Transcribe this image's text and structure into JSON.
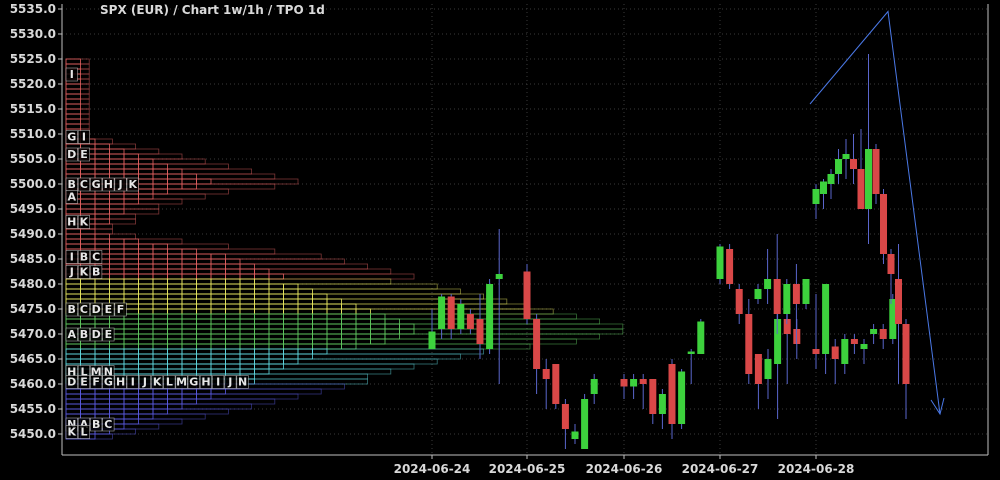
{
  "header": {
    "title": "SPX (EUR) /  Chart 1w/1h / TPO 1d"
  },
  "colors": {
    "background": "#000000",
    "grid": "#3a3a3a",
    "axis": "#bfbfbf",
    "text": "#d9d9d9",
    "bull": "#3dd13d",
    "bear": "#d94848",
    "wick": "#5a66cc",
    "trend": "#4a78e6",
    "tpo_red": "#e06060",
    "tpo_yellow": "#e8e860",
    "tpo_green": "#60c860",
    "tpo_cyan": "#60d8e0",
    "tpo_blue": "#5a5ae0"
  },
  "chart_data": {
    "type": "candlestick",
    "title": "SPX (EUR) /  Chart 1w/1h / TPO 1d",
    "y_ticks": [
      5450.0,
      5455.0,
      5460.0,
      5465.0,
      5470.0,
      5475.0,
      5480.0,
      5485.0,
      5490.0,
      5495.0,
      5500.0,
      5505.0,
      5510.0,
      5515.0,
      5520.0,
      5525.0,
      5530.0,
      5535.0
    ],
    "y_range": [
      5447.0,
      5536.0
    ],
    "y_axis_position": "left",
    "x_ticks": [
      "2024-06-24",
      "2024-06-25",
      "2024-06-26",
      "2024-06-27",
      "2024-06-28"
    ],
    "grid": true,
    "candles": [
      {
        "day": 0,
        "hour": 0,
        "o": 5467.0,
        "h": 5475.0,
        "l": 5467.0,
        "c": 5470.5
      },
      {
        "day": 0,
        "hour": 1,
        "o": 5471.0,
        "h": 5478.0,
        "l": 5469.0,
        "c": 5477.5
      },
      {
        "day": 0,
        "hour": 2,
        "o": 5477.5,
        "h": 5478.0,
        "l": 5469.0,
        "c": 5471.0
      },
      {
        "day": 0,
        "hour": 3,
        "o": 5471.0,
        "h": 5477.0,
        "l": 5470.0,
        "c": 5476.0
      },
      {
        "day": 0,
        "hour": 4,
        "o": 5474.0,
        "h": 5475.0,
        "l": 5470.0,
        "c": 5471.0
      },
      {
        "day": 0,
        "hour": 5,
        "o": 5473.0,
        "h": 5478.0,
        "l": 5465.0,
        "c": 5468.0
      },
      {
        "day": 0,
        "hour": 6,
        "o": 5467.0,
        "h": 5481.0,
        "l": 5466.0,
        "c": 5480.0
      },
      {
        "day": 0,
        "hour": 7,
        "o": 5481.0,
        "h": 5491.0,
        "l": 5460.0,
        "c": 5482.0
      },
      {
        "day": 1,
        "hour": 0,
        "o": 5482.5,
        "h": 5484.0,
        "l": 5472.0,
        "c": 5473.0
      },
      {
        "day": 1,
        "hour": 1,
        "o": 5473.0,
        "h": 5474.0,
        "l": 5458.0,
        "c": 5463.0
      },
      {
        "day": 1,
        "hour": 2,
        "o": 5463.0,
        "h": 5465.0,
        "l": 5455.0,
        "c": 5461.0
      },
      {
        "day": 1,
        "hour": 3,
        "o": 5464.0,
        "h": 5464.0,
        "l": 5455.0,
        "c": 5456.0
      },
      {
        "day": 1,
        "hour": 4,
        "o": 5456.0,
        "h": 5457.0,
        "l": 5447.0,
        "c": 5451.0
      },
      {
        "day": 1,
        "hour": 5,
        "o": 5449.0,
        "h": 5452.0,
        "l": 5448.0,
        "c": 5450.5
      },
      {
        "day": 1,
        "hour": 6,
        "o": 5447.0,
        "h": 5458.0,
        "l": 5447.0,
        "c": 5457.0
      },
      {
        "day": 1,
        "hour": 7,
        "o": 5458.0,
        "h": 5462.0,
        "l": 5456.0,
        "c": 5461.0
      },
      {
        "day": 2,
        "hour": 0,
        "o": 5461.0,
        "h": 5462.0,
        "l": 5457.0,
        "c": 5459.5
      },
      {
        "day": 2,
        "hour": 1,
        "o": 5459.5,
        "h": 5462.0,
        "l": 5457.0,
        "c": 5461.0
      },
      {
        "day": 2,
        "hour": 2,
        "o": 5461.0,
        "h": 5462.0,
        "l": 5455.0,
        "c": 5460.0
      },
      {
        "day": 2,
        "hour": 3,
        "o": 5461.0,
        "h": 5461.0,
        "l": 5452.0,
        "c": 5454.0
      },
      {
        "day": 2,
        "hour": 4,
        "o": 5454.0,
        "h": 5459.0,
        "l": 5451.0,
        "c": 5458.0
      },
      {
        "day": 2,
        "hour": 5,
        "o": 5464.0,
        "h": 5465.0,
        "l": 5449.0,
        "c": 5452.0
      },
      {
        "day": 2,
        "hour": 6,
        "o": 5452.0,
        "h": 5463.0,
        "l": 5451.0,
        "c": 5462.5
      },
      {
        "day": 2,
        "hour": 7,
        "o": 5466.0,
        "h": 5467.0,
        "l": 5460.0,
        "c": 5466.5
      },
      {
        "day": 2,
        "hour": 8,
        "o": 5466.0,
        "h": 5473.0,
        "l": 5466.0,
        "c": 5472.5
      },
      {
        "day": 3,
        "hour": 0,
        "o": 5481.0,
        "h": 5488.0,
        "l": 5480.0,
        "c": 5487.5
      },
      {
        "day": 3,
        "hour": 1,
        "o": 5487.0,
        "h": 5488.0,
        "l": 5479.0,
        "c": 5480.0
      },
      {
        "day": 3,
        "hour": 2,
        "o": 5479.0,
        "h": 5480.0,
        "l": 5472.0,
        "c": 5474.0
      },
      {
        "day": 3,
        "hour": 3,
        "o": 5474.0,
        "h": 5477.0,
        "l": 5460.0,
        "c": 5462.0
      },
      {
        "day": 3,
        "hour": 4,
        "o": 5466.0,
        "h": 5466.0,
        "l": 5455.0,
        "c": 5460.0
      },
      {
        "day": 3,
        "hour": 5,
        "o": 5461.0,
        "h": 5467.0,
        "l": 5457.0,
        "c": 5465.0
      },
      {
        "day": 3,
        "hour": 6,
        "o": 5464.0,
        "h": 5474.0,
        "l": 5453.0,
        "c": 5473.0
      },
      {
        "day": 3,
        "hour": 7,
        "o": 5473.0,
        "h": 5474.0,
        "l": 5460.0,
        "c": 5470.0
      },
      {
        "day": 3,
        "hour": 8,
        "o": 5471.0,
        "h": 5473.0,
        "l": 5465.0,
        "c": 5468.0
      },
      {
        "day": 4,
        "hour": 0,
        "o": 5467.0,
        "h": 5478.0,
        "l": 5463.0,
        "c": 5466.0
      },
      {
        "day": 4,
        "hour": 1,
        "o": 5466.0,
        "h": 5476.0,
        "l": 5462.0,
        "c": 5480.0
      },
      {
        "day": 4,
        "hour": 2,
        "o": 5467.5,
        "h": 5469.0,
        "l": 5460.0,
        "c": 5465.0
      },
      {
        "day": 4,
        "hour": 3,
        "o": 5464.0,
        "h": 5470.0,
        "l": 5462.0,
        "c": 5469.0
      },
      {
        "day": 4,
        "hour": 4,
        "o": 5469.0,
        "h": 5470.0,
        "l": 5466.0,
        "c": 5468.0
      },
      {
        "day": 4,
        "hour": 5,
        "o": 5467.0,
        "h": 5469.0,
        "l": 5464.0,
        "c": 5468.0
      },
      {
        "day": 4,
        "hour": 6,
        "o": 5470.0,
        "h": 5472.0,
        "l": 5468.0,
        "c": 5471.0
      },
      {
        "day": 4,
        "hour": 7,
        "o": 5471.0,
        "h": 5472.0,
        "l": 5467.0,
        "c": 5469.0
      },
      {
        "day": 4,
        "hour": 8,
        "o": 5469.0,
        "h": 5478.0,
        "l": 5468.0,
        "c": 5477.0
      },
      {
        "day": 5,
        "hour": 0,
        "o": 5477.0,
        "h": 5480.0,
        "l": 5476.0,
        "c": 5479.0
      },
      {
        "day": 5,
        "hour": 1,
        "o": 5479.0,
        "h": 5487.0,
        "l": 5476.0,
        "c": 5481.0
      },
      {
        "day": 5,
        "hour": 2,
        "o": 5481.0,
        "h": 5490.0,
        "l": 5470.0,
        "c": 5474.0
      },
      {
        "day": 5,
        "hour": 3,
        "o": 5474.0,
        "h": 5481.0,
        "l": 5472.0,
        "c": 5480.0
      },
      {
        "day": 5,
        "hour": 4,
        "o": 5480.0,
        "h": 5484.0,
        "l": 5468.0,
        "c": 5476.0
      },
      {
        "day": 5,
        "hour": 5,
        "o": 5476.0,
        "h": 5481.0,
        "l": 5475.0,
        "c": 5481.0
      },
      {
        "day": 6,
        "hour": 0,
        "o": 5496.0,
        "h": 5500.0,
        "l": 5493.0,
        "c": 5499.0
      },
      {
        "day": 6,
        "hour": 1,
        "o": 5498.0,
        "h": 5501.0,
        "l": 5495.0,
        "c": 5500.5
      },
      {
        "day": 6,
        "hour": 2,
        "o": 5500.0,
        "h": 5503.0,
        "l": 5497.0,
        "c": 5502.0
      },
      {
        "day": 6,
        "hour": 3,
        "o": 5502.0,
        "h": 5507.0,
        "l": 5500.0,
        "c": 5505.0
      },
      {
        "day": 6,
        "hour": 4,
        "o": 5505.0,
        "h": 5509.0,
        "l": 5501.0,
        "c": 5506.0
      },
      {
        "day": 6,
        "hour": 5,
        "o": 5505.0,
        "h": 5510.0,
        "l": 5500.0,
        "c": 5503.0
      },
      {
        "day": 6,
        "hour": 6,
        "o": 5503.0,
        "h": 5511.0,
        "l": 5495.0,
        "c": 5495.0
      },
      {
        "day": 6,
        "hour": 7,
        "o": 5495.0,
        "h": 5526.0,
        "l": 5488.0,
        "c": 5507.0
      },
      {
        "day": 6,
        "hour": 8,
        "o": 5507.0,
        "h": 5508.0,
        "l": 5496.0,
        "c": 5498.0
      },
      {
        "day": 6,
        "hour": 9,
        "o": 5498.0,
        "h": 5499.0,
        "l": 5484.0,
        "c": 5486.0
      },
      {
        "day": 6,
        "hour": 10,
        "o": 5486.0,
        "h": 5487.0,
        "l": 5476.0,
        "c": 5482.0
      },
      {
        "day": 6,
        "hour": 11,
        "o": 5481.0,
        "h": 5488.0,
        "l": 5460.0,
        "c": 5472.0
      },
      {
        "day": 6,
        "hour": 12,
        "o": 5472.0,
        "h": 5473.0,
        "l": 5453.0,
        "c": 5460.0
      }
    ],
    "tpo_profile": {
      "label_columns": [
        {
          "price": 5522.0,
          "letters": [
            "I"
          ]
        },
        {
          "price": 5509.5,
          "letters": [
            "G",
            "I"
          ]
        },
        {
          "price": 5506.0,
          "letters": [
            "D",
            "E"
          ]
        },
        {
          "price": 5500.0,
          "letters": [
            "B",
            "C",
            "G",
            "H",
            "J",
            "K"
          ]
        },
        {
          "price": 5497.5,
          "letters": [
            "A"
          ]
        },
        {
          "price": 5492.5,
          "letters": [
            "H",
            "K"
          ]
        },
        {
          "price": 5485.5,
          "letters": [
            "I",
            "B",
            "C"
          ]
        },
        {
          "price": 5482.5,
          "letters": [
            "J",
            "K",
            "B"
          ]
        },
        {
          "price": 5475.0,
          "letters": [
            "B",
            "C",
            "D",
            "E",
            "F"
          ]
        },
        {
          "price": 5470.0,
          "letters": [
            "A",
            "B",
            "D",
            "E"
          ]
        },
        {
          "price": 5462.5,
          "letters": [
            "H",
            "L",
            "M",
            "N"
          ]
        },
        {
          "price": 5460.5,
          "letters": [
            "D",
            "E",
            "F",
            "G",
            "H",
            "I",
            "J",
            "K",
            "L",
            "M",
            "G",
            "H",
            "I",
            "J",
            "N"
          ]
        },
        {
          "price": 5452.0,
          "letters": [
            "N",
            "A",
            "B",
            "C"
          ]
        },
        {
          "price": 5450.5,
          "letters": [
            "K",
            "L"
          ]
        }
      ],
      "bands": [
        {
          "from": 5525.0,
          "to": 5508.0,
          "color": "red",
          "widths": [
            1,
            1,
            1,
            1,
            1,
            1,
            1,
            1,
            1,
            1,
            1,
            1,
            1,
            1,
            1,
            1,
            2
          ]
        },
        {
          "from": 5508.0,
          "to": 5490.0,
          "color": "red",
          "widths": [
            3,
            4,
            5,
            6,
            7,
            8,
            9,
            10,
            9,
            7,
            6,
            5,
            4,
            4,
            3,
            3,
            2,
            2
          ]
        },
        {
          "from": 5490.0,
          "to": 5481.0,
          "color": "red",
          "widths": [
            3,
            5,
            7,
            9,
            11,
            12,
            13,
            14,
            15
          ]
        },
        {
          "from": 5481.0,
          "to": 5474.0,
          "color": "yellow",
          "widths": [
            14,
            16,
            17,
            18,
            19,
            20,
            21
          ]
        },
        {
          "from": 5474.0,
          "to": 5467.0,
          "color": "green",
          "widths": [
            22,
            23,
            24,
            24,
            23,
            22,
            20
          ]
        },
        {
          "from": 5467.0,
          "to": 5460.0,
          "color": "cyan",
          "widths": [
            18,
            17,
            16,
            15,
            14,
            13,
            13
          ]
        },
        {
          "from": 5460.0,
          "to": 5449.0,
          "color": "blue",
          "widths": [
            12,
            11,
            10,
            9,
            8,
            7,
            6,
            5,
            4,
            3,
            2
          ]
        }
      ]
    },
    "annotations": [
      {
        "type": "trendline",
        "points": [
          [
            5.85,
            5516.0
          ],
          [
            6.55,
            5534.5
          ],
          [
            7.05,
            5454.0
          ]
        ],
        "arrow": true
      }
    ]
  }
}
